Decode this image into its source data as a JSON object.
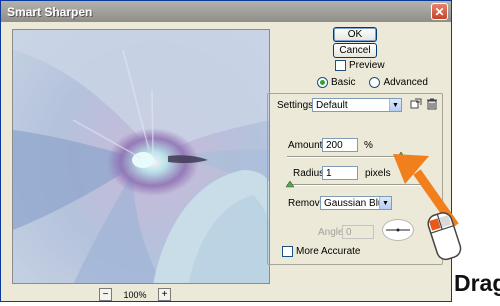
{
  "window": {
    "title": "Smart Sharpen",
    "close_label": "✕"
  },
  "buttons": {
    "ok": "OK",
    "cancel": "Cancel"
  },
  "preview": {
    "checkbox_label": "Preview",
    "checked": false,
    "zoom_level": "100%",
    "zoom_out": "−",
    "zoom_in": "+"
  },
  "mode": {
    "basic": "Basic",
    "advanced": "Advanced",
    "selected": "Basic"
  },
  "settings": {
    "label": "Settings:",
    "value": "Default"
  },
  "amount": {
    "label": "Amount:",
    "value": "200",
    "unit": "%",
    "slider_fraction": 0.82
  },
  "radius": {
    "label": "Radius:",
    "value": "1",
    "unit": "pixels",
    "slider_fraction": 0.0
  },
  "remove": {
    "label": "Remove:",
    "value": "Gaussian Blur"
  },
  "angle": {
    "label": "Angle:",
    "value": "0",
    "enabled": false
  },
  "more_accurate": {
    "label": "More Accurate",
    "checked": false
  },
  "annotation": {
    "text": "Drag",
    "arrow_color": "#f07f1c"
  },
  "icons": {
    "save": "save-settings-icon",
    "delete": "delete-settings-icon",
    "mouse": "mouse-icon"
  }
}
